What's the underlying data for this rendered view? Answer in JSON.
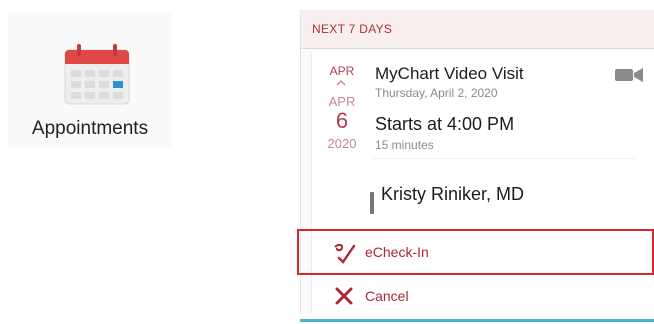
{
  "app_tile": {
    "icon": "calendar-icon",
    "label": "Appointments",
    "colors": {
      "calendar_top": "#e04848",
      "calendar_mark": "#2f8fd8"
    }
  },
  "section": {
    "header": "NEXT 7 DAYS"
  },
  "appointment": {
    "month_label": "APR",
    "month_label_faded": "APR",
    "day": "6",
    "year": "2020",
    "title": "MyChart Video Visit",
    "date_text": "Thursday, April 2, 2020",
    "start_time": "Starts at 4:00 PM",
    "duration": "15 minutes",
    "provider": "Kristy Riniker, MD",
    "type_icon": "video-camera-icon"
  },
  "actions": [
    {
      "label": "eCheck-In",
      "icon": "echeckin-icon",
      "color": "#a82834"
    },
    {
      "label": "Cancel",
      "icon": "x-icon",
      "color": "#a82834"
    }
  ],
  "colors": {
    "accent": "#b0303a",
    "highlight_border": "#d7262e",
    "bottom_rule": "#4fb1c9"
  }
}
